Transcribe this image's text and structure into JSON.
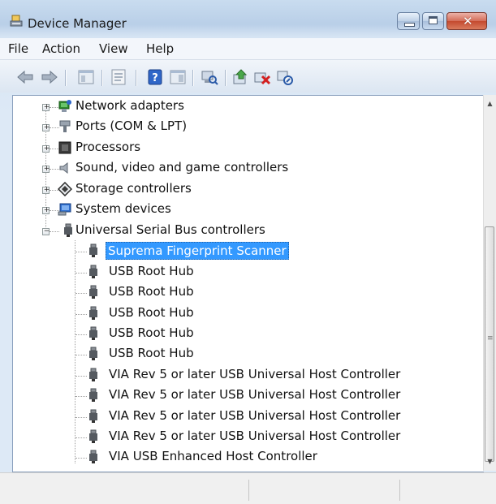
{
  "window": {
    "title": "Device Manager",
    "icons": {
      "app": "device-manager-icon",
      "minimize": "minimize-icon",
      "maximize": "maximize-icon",
      "close": "close-icon"
    },
    "close_glyph": "✕"
  },
  "menu": {
    "items": [
      {
        "label": "File"
      },
      {
        "label": "Action"
      },
      {
        "label": "View"
      },
      {
        "label": "Help"
      }
    ]
  },
  "toolbar": {
    "buttons": [
      "back-icon",
      "forward-icon",
      "console-tree-icon",
      "properties-icon",
      "help-icon",
      "action-pane-icon",
      "scan-hardware-icon",
      "update-driver-icon",
      "uninstall-icon",
      "disable-icon"
    ]
  },
  "tree": {
    "categories": [
      {
        "label": "Network adapters",
        "icon": "network-adapter-icon",
        "expander": "+"
      },
      {
        "label": "Ports (COM & LPT)",
        "icon": "port-icon",
        "expander": "+"
      },
      {
        "label": "Processors",
        "icon": "processor-icon",
        "expander": "+"
      },
      {
        "label": "Sound, video and game controllers",
        "icon": "speaker-icon",
        "expander": "+"
      },
      {
        "label": "Storage controllers",
        "icon": "storage-icon",
        "expander": "+"
      },
      {
        "label": "System devices",
        "icon": "computer-icon",
        "expander": "+"
      },
      {
        "label": "Universal Serial Bus controllers",
        "icon": "usb-icon",
        "expander": "−"
      }
    ],
    "usb_children": [
      {
        "label": "Suprema Fingerprint Scanner",
        "selected": true
      },
      {
        "label": "USB Root Hub"
      },
      {
        "label": "USB Root Hub"
      },
      {
        "label": "USB Root Hub"
      },
      {
        "label": "USB Root Hub"
      },
      {
        "label": "USB Root Hub"
      },
      {
        "label": "VIA Rev 5 or later USB Universal Host Controller"
      },
      {
        "label": "VIA Rev 5 or later USB Universal Host Controller"
      },
      {
        "label": "VIA Rev 5 or later USB Universal Host Controller"
      },
      {
        "label": "VIA Rev 5 or later USB Universal Host Controller"
      },
      {
        "label": "VIA USB Enhanced Host Controller"
      }
    ]
  },
  "scrollbar": {
    "up": "▲",
    "down": "▼",
    "grip": "≡"
  },
  "colors": {
    "selection": "#3399ff",
    "title_bg": "#c9dcef",
    "close_button": "#c44a2f"
  }
}
